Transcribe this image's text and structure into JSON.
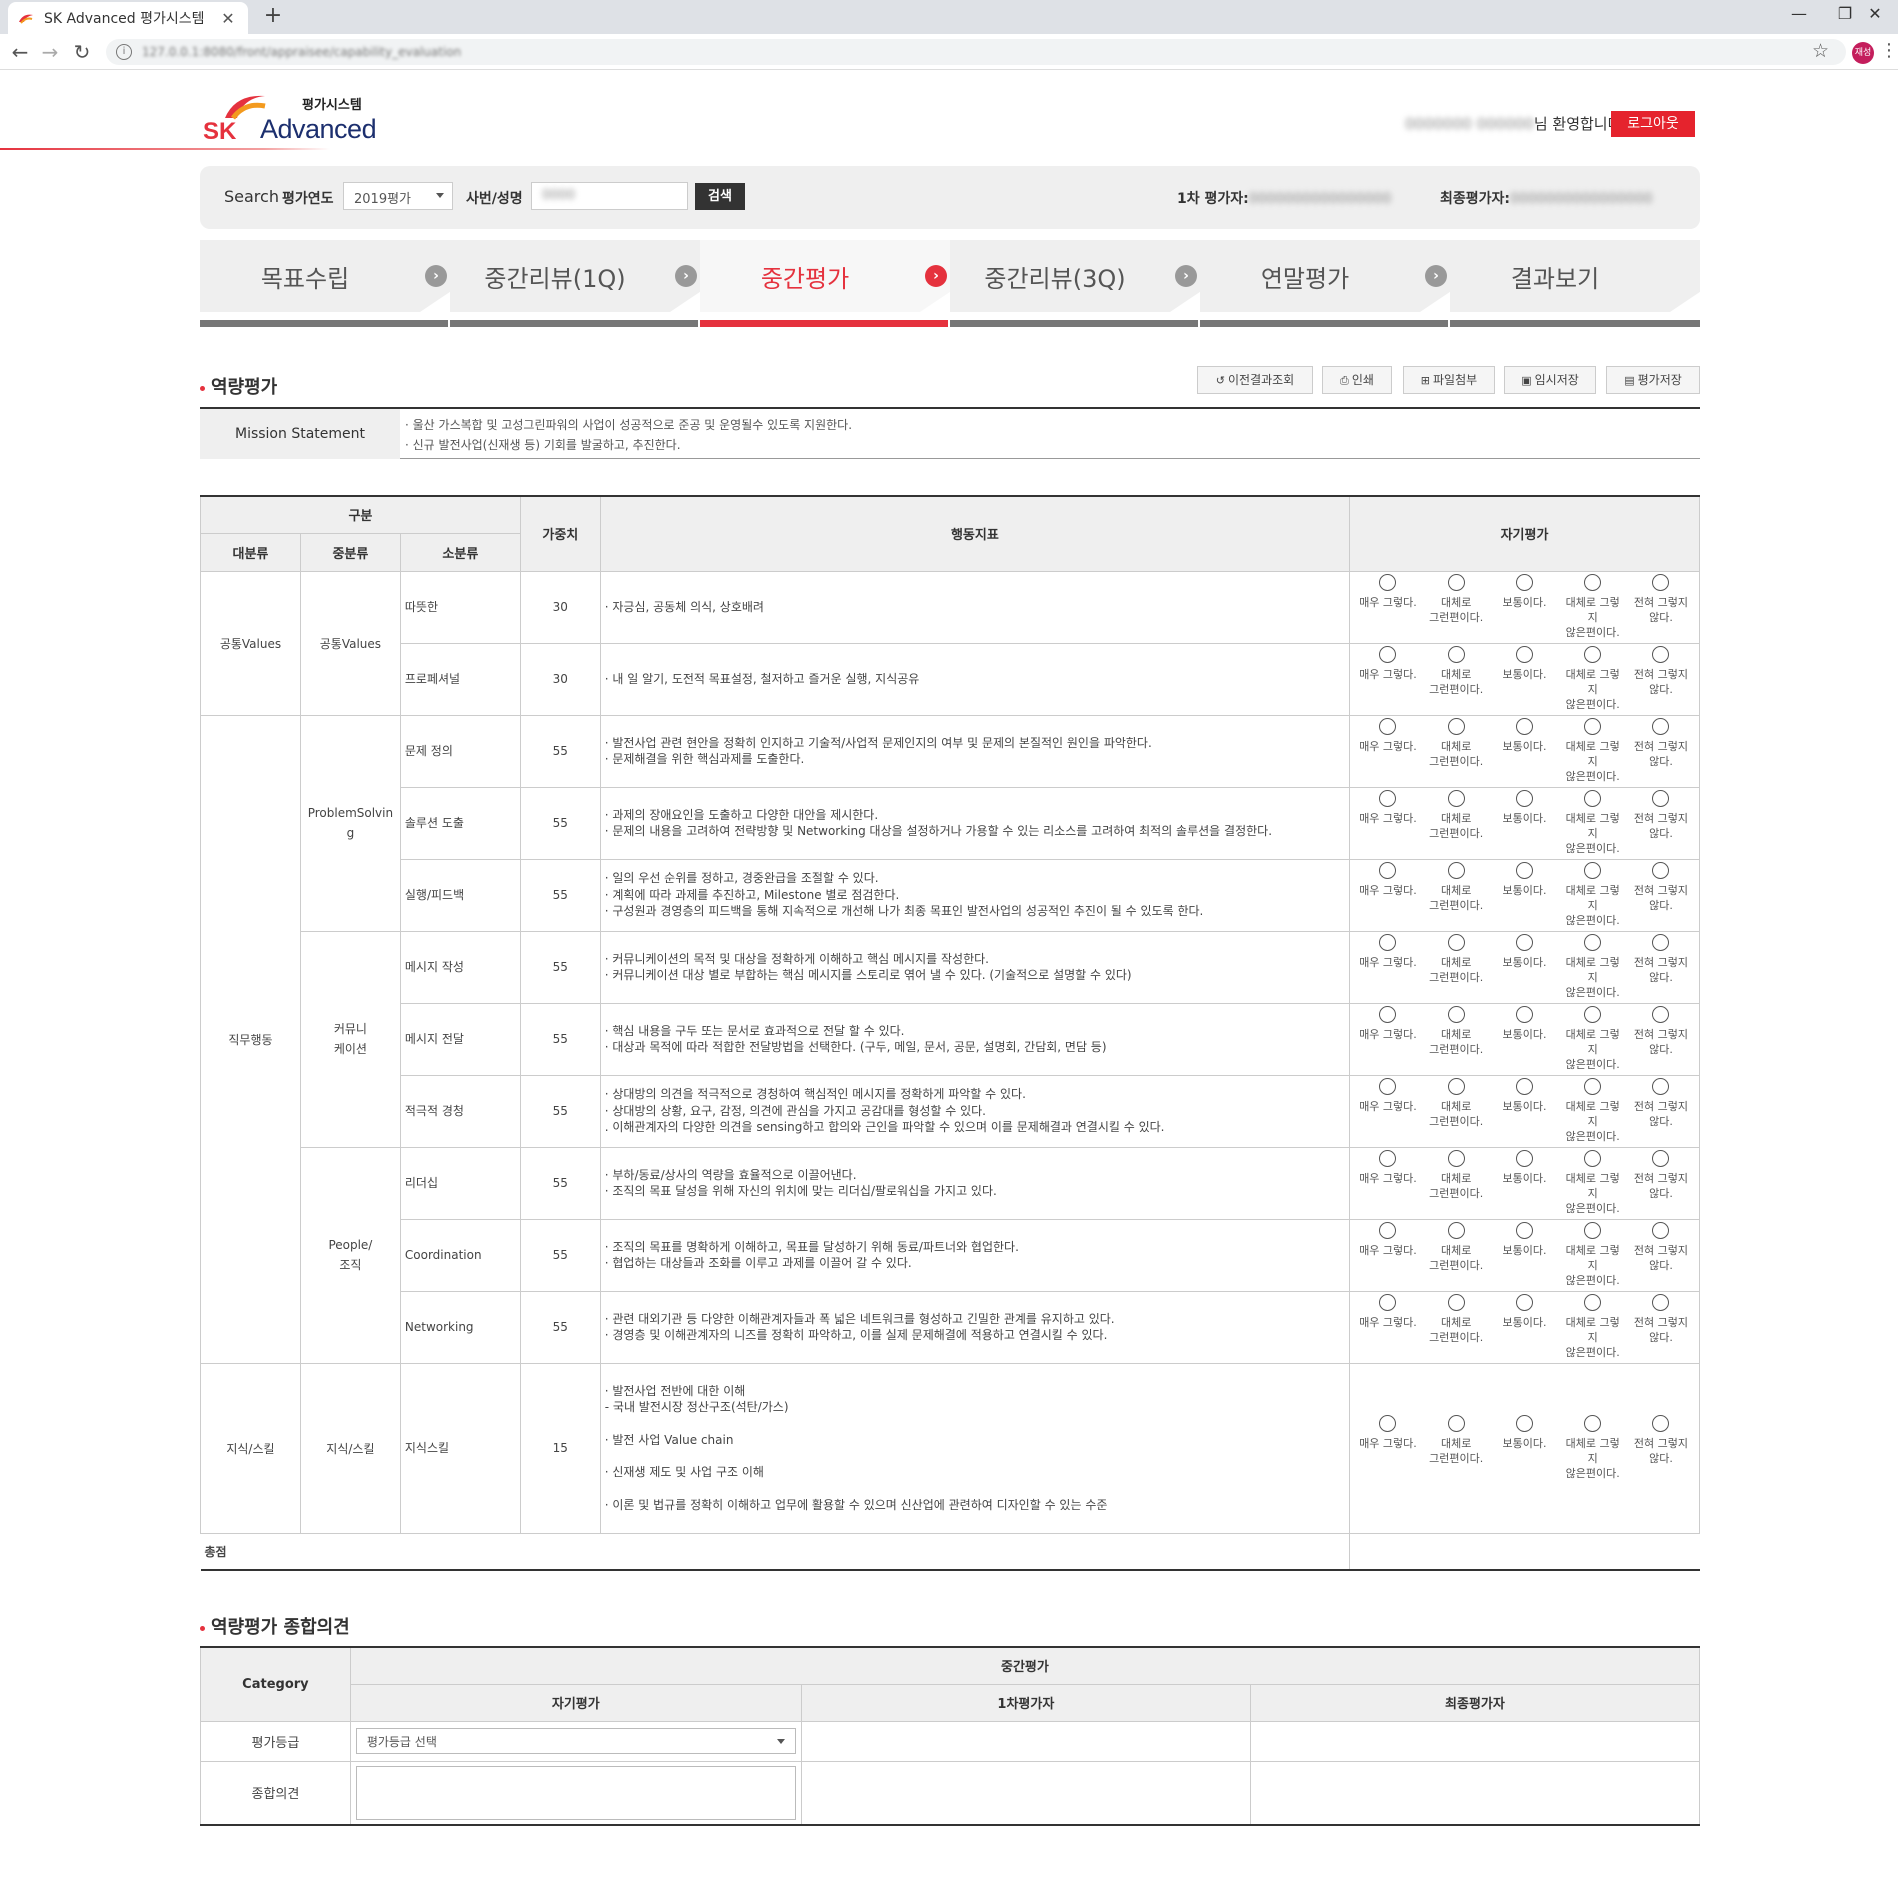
{
  "browser": {
    "tab_title": "SK Advanced 평가시스템",
    "url": "127.0.0.1:8080/front/appraisee/capability_evaluation",
    "profile_label": "재성"
  },
  "header": {
    "logo_sk": "SK",
    "logo_sub": "평가시스템",
    "logo_advanced": "Advanced",
    "welcome_name": "0000000 000000",
    "welcome_suffix": "님 환영합니다.",
    "logout": "로그아웃"
  },
  "search": {
    "label": "Search",
    "year_label": "평가연도",
    "year_value": "2019평가",
    "name_label": "사번/성명",
    "name_value": "0000",
    "button": "검색",
    "first_evaluator_label": "1차 평가자:",
    "first_evaluator_value": "0000000000000000",
    "final_evaluator_label": "최종평가자:",
    "final_evaluator_value": "0000000000000000"
  },
  "steps": [
    {
      "label": "목표수립",
      "active": false
    },
    {
      "label": "중간리뷰(1Q)",
      "active": false
    },
    {
      "label": "중간평가",
      "active": true
    },
    {
      "label": "중간리뷰(3Q)",
      "active": false
    },
    {
      "label": "연말평가",
      "active": false
    },
    {
      "label": "결과보기",
      "active": false
    }
  ],
  "section1": {
    "title": "역량평가",
    "buttons": {
      "history": "이전결과조회",
      "print": "인쇄",
      "attach": "파일첨부",
      "temp_save": "임시저장",
      "save": "평가저장"
    }
  },
  "mission": {
    "label": "Mission Statement",
    "line1": "· 울산 가스복합 및 고성그린파워의 사업이 성공적으로 준공 및 운영될수 있도록 지원한다.",
    "line2": "· 신규 발전사업(신재생 등) 기회를 발굴하고, 추진한다."
  },
  "table": {
    "h_group": "구분",
    "h_major": "대분류",
    "h_middle": "중분류",
    "h_minor": "소분류",
    "h_weight": "가중치",
    "h_indicator": "행동지표",
    "h_self": "자기평가",
    "options": [
      [
        "매우 그렇다.",
        ""
      ],
      [
        "대체로",
        "그런편이다."
      ],
      [
        "보통이다.",
        ""
      ],
      [
        "대체로 그렇지",
        "않은편이다."
      ],
      [
        "전혀 그렇지",
        "않다."
      ]
    ],
    "majors": {
      "common": "공통Values",
      "job": "직무행동",
      "skill": "지식/스킬"
    },
    "middles": {
      "common": "공통Values",
      "ps1": "ProblemSolvin",
      "ps2": "g",
      "comm1": "커뮤니",
      "comm2": "케이션",
      "people1": "People/",
      "people2": "조직",
      "skill": "지식/스킬"
    },
    "rows": [
      {
        "minor": "따뜻한",
        "weight": "30",
        "lines": [
          "· 자긍심, 공동체 의식, 상호배려"
        ]
      },
      {
        "minor": "프로페셔널",
        "weight": "30",
        "lines": [
          "· 내 일 알기, 도전적 목표설정, 철저하고 즐거운 실행, 지식공유"
        ]
      },
      {
        "minor": "문제 정의",
        "weight": "55",
        "lines": [
          "· 발전사업 관련 현안을 정확히 인지하고 기술적/사업적 문제인지의 여부 및 문제의 본질적인 원인을 파악한다.",
          "· 문제해결을 위한 핵심과제를 도출한다."
        ]
      },
      {
        "minor": "솔루션 도출",
        "weight": "55",
        "lines": [
          "· 과제의 장애요인을 도출하고 다양한 대안을 제시한다.",
          "· 문제의 내용을 고려하여 전략방향 및 Networking 대상을 설정하거나 가용할 수 있는 리소스를 고려하여 최적의 솔루션을 결정한다."
        ]
      },
      {
        "minor": "실행/피드백",
        "weight": "55",
        "lines": [
          "· 일의 우선 순위를 정하고, 경중완급을 조절할 수 있다.",
          "· 계획에 따라 과제를 추진하고, Milestone 별로 점검한다.",
          "· 구성원과 경영층의 피드백을 통해 지속적으로 개선해 나가 최종 목표인 발전사업의 성공적인 추진이 될 수 있도록 한다."
        ]
      },
      {
        "minor": "메시지 작성",
        "weight": "55",
        "lines": [
          "· 커뮤니케이션의 목적 및 대상을 정확하게 이해하고 핵심 메시지를 작성한다.",
          "· 커뮤니케이션 대상 별로 부합하는 핵심 메시지를 스토리로 엮어 낼 수 있다. (기술적으로 설명할 수 있다)"
        ]
      },
      {
        "minor": "메시지 전달",
        "weight": "55",
        "lines": [
          "· 핵심 내용을 구두 또는 문서로 효과적으로 전달 할 수 있다.",
          "· 대상과 목적에 따라 적합한 전달방법을 선택한다. (구두, 메일, 문서, 공문, 설명회, 간담회, 면담 등)"
        ]
      },
      {
        "minor": "적극적 경청",
        "weight": "55",
        "lines": [
          "· 상대방의 의견을 적극적으로 경청하여 핵심적인 메시지를 정확하게 파악할 수 있다.",
          "· 상대방의 상황, 요구, 감정, 의견에 관심을 가지고 공감대를 형성할 수 있다.",
          ". 이해관계자의 다양한 의견을 sensing하고 합의와 근인을 파악할 수 있으며 이를 문제해결과 연결시킬 수 있다."
        ]
      },
      {
        "minor": "리더십",
        "weight": "55",
        "lines": [
          "· 부하/동료/상사의 역량을 효율적으로 이끌어낸다.",
          "· 조직의 목표 달성을 위해 자신의 위치에 맞는 리더십/팔로워십을 가지고 있다."
        ]
      },
      {
        "minor": "Coordination",
        "weight": "55",
        "lines": [
          "· 조직의 목표를 명확하게 이해하고, 목표를 달성하기 위해 동료/파트너와 협업한다.",
          "· 협업하는 대상들과 조화를 이루고 과제를 이끌어 갈 수 있다."
        ]
      },
      {
        "minor": "Networking",
        "weight": "55",
        "lines": [
          "· 관련 대외기관 등 다양한 이해관계자들과 폭 넓은 네트워크를 형성하고 긴밀한 관계를 유지하고 있다.",
          "· 경영층 및 이해관계자의 니즈를 정확히 파악하고, 이를 실제 문제해결에 적용하고 연결시킬 수 있다."
        ]
      },
      {
        "minor": "지식스킬",
        "weight": "15",
        "lines": [
          "· 발전사업 전반에 대한 이해",
          "- 국내 발전시장 정산구조(석탄/가스)",
          "",
          "· 발전 사업 Value chain",
          "",
          "· 신재생 제도 및 사업 구조 이해",
          "",
          "· 이론 및 법규를 정확히 이해하고 업무에 활용할 수 있으며 신산업에 관련하여 디자인할 수 있는 수준"
        ]
      }
    ],
    "total_label": "총점"
  },
  "section2": {
    "title": "역량평가 종합의견",
    "category": "Category",
    "mid_eval": "중간평가",
    "self": "자기평가",
    "first": "1차평가자",
    "final": "최종평가자",
    "grade_label": "평가등급",
    "grade_placeholder": "평가등급 선택",
    "opinion_label": "종합의견"
  },
  "colors": {
    "accent": "#e5323e",
    "header_bg": "#efefef"
  }
}
